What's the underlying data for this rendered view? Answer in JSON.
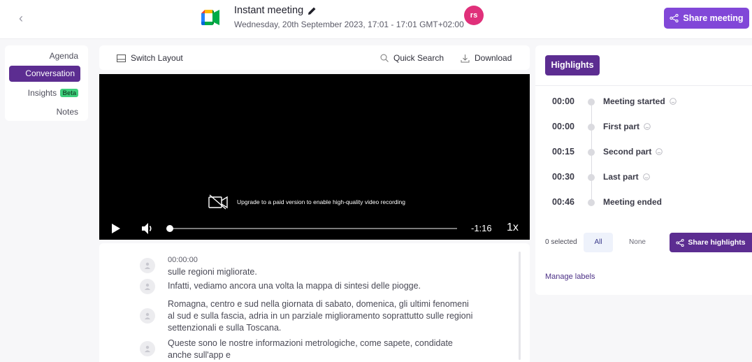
{
  "header": {
    "back_icon": "chevron-left-icon",
    "logo": "google-meet-logo",
    "title": "Instant meeting",
    "subtitle": "Wednesday, 20th September 2023, 17:01 - 17:01 GMT+02:00",
    "avatar_initials": "rs",
    "share_label": "Share meeting"
  },
  "colors": {
    "accent": "#8147d8",
    "accent_dark": "#5c2d91",
    "avatar": "#e0307a",
    "beta": "#3ecf7c"
  },
  "sidebar": {
    "items": [
      {
        "label": "Agenda",
        "active": false
      },
      {
        "label": "Conversation",
        "active": true
      },
      {
        "label": "Insights",
        "active": false,
        "badge": "Beta"
      },
      {
        "label": "Notes",
        "active": false
      }
    ]
  },
  "toolbar": {
    "switch_layout": "Switch Layout",
    "quick_search": "Quick Search",
    "download": "Download"
  },
  "video": {
    "upgrade_text": "Upgrade to a paid version to enable high-quality video recording",
    "time_remaining": "-1:16",
    "speed": "1x",
    "progress": 0
  },
  "transcript": {
    "segments": [
      {
        "timestamp": "00:00:00",
        "text": "sulle regioni migliorate."
      },
      {
        "timestamp": "",
        "text": "Infatti, vediamo ancora una volta la mappa di sintesi delle piogge."
      },
      {
        "timestamp": "",
        "text": "Romagna, centro e sud nella giornata di sabato, domenica, gli ultimi fenomeni al sud e sulla fascia, adria in un parziale miglioramento soprattutto sulle regioni settenzionali e sulla Toscana."
      },
      {
        "timestamp": "",
        "text": "Queste sono le nostre informazioni metrologiche, come sapete, condidate anche sull'app e"
      }
    ]
  },
  "highlights": {
    "tab_label": "Highlights",
    "items": [
      {
        "time": "00:00",
        "label": "Meeting started",
        "has_emoji": true
      },
      {
        "time": "00:00",
        "label": "First part",
        "has_emoji": true
      },
      {
        "time": "00:15",
        "label": "Second part",
        "has_emoji": true
      },
      {
        "time": "00:30",
        "label": "Last part",
        "has_emoji": true
      },
      {
        "time": "00:46",
        "label": "Meeting ended",
        "has_emoji": false
      }
    ],
    "selected_text": "0 selected",
    "all_label": "All",
    "none_label": "None",
    "share_label": "Share highlights",
    "manage_labels": "Manage labels"
  }
}
